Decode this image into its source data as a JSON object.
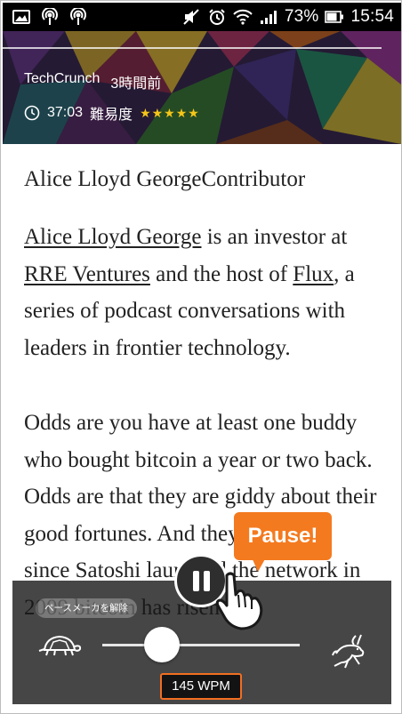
{
  "status_bar": {
    "battery": "73%",
    "time": "15:54",
    "icons": [
      "image-icon",
      "podcast-icon",
      "podcast-icon",
      "mute-icon",
      "alarm-icon",
      "wifi-icon",
      "signal-icon",
      "battery-icon"
    ]
  },
  "header": {
    "source": "TechCrunch",
    "age": "3時間前",
    "duration": "37:03",
    "difficulty_label": "難易度",
    "stars": "★★★★★",
    "star_color": "#f5c518"
  },
  "article": {
    "byline": "Alice Lloyd GeorgeContributor",
    "p1": {
      "link1": "Alice Lloyd George",
      "t1": " is an investor at ",
      "link2": "RRE Ventures",
      "t2": " and the host of ",
      "link3": "Flux",
      "t3": ", a series of podcast conversations with leaders in frontier technology."
    },
    "p2": "Odds are you have at least one buddy who bought bitcoin a year or two back. Odds are that they are giddy about their good fortunes. And they should be since Satoshi launched the network in 2009 bitcoin has risen"
  },
  "player": {
    "pace_release_label": "ペースメーカを解除",
    "wpm": "145 WPM",
    "slider_fraction": 0.3,
    "tooltip": "Pause!",
    "accent": "#f26f21",
    "slow_icon": "turtle-icon",
    "fast_icon": "rabbit-icon",
    "pause_icon": "pause-icon",
    "hint_icon": "tap-hand-icon"
  }
}
